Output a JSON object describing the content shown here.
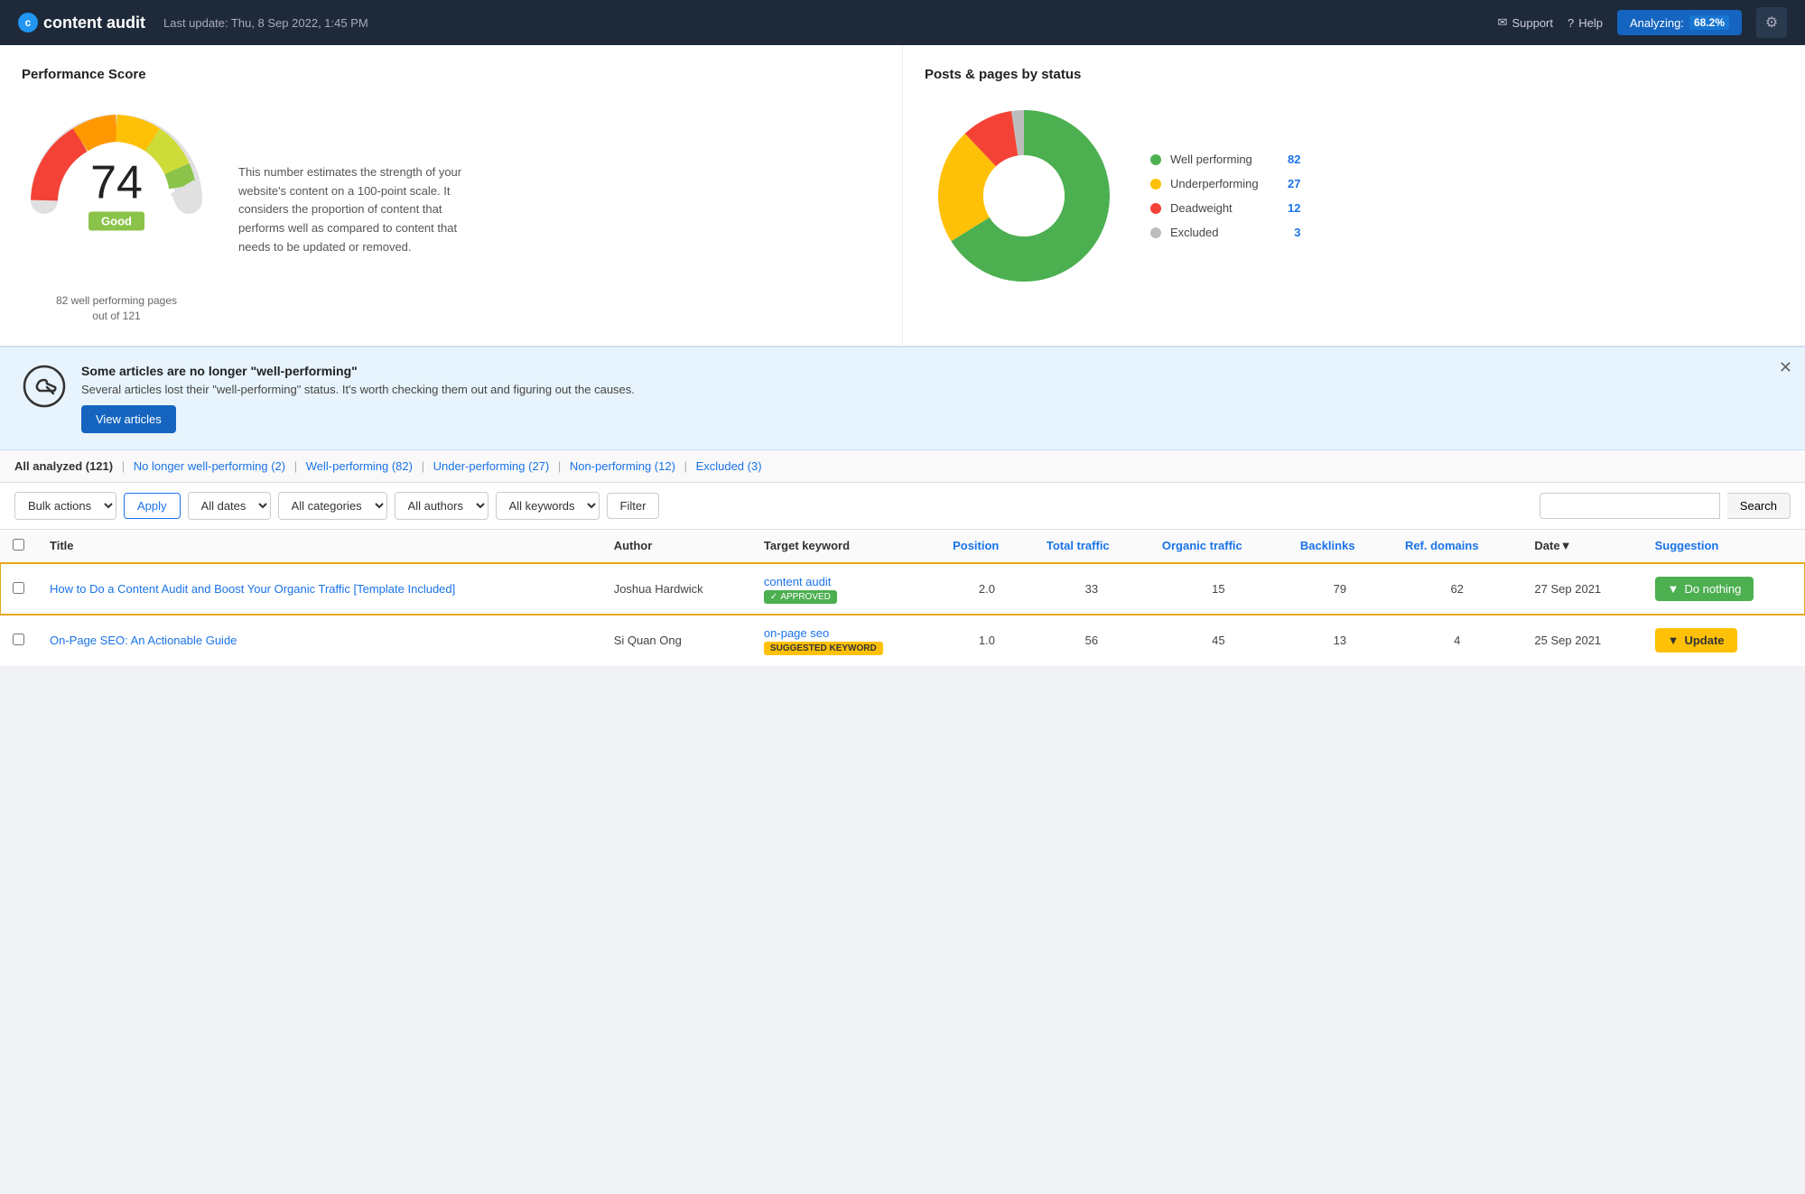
{
  "header": {
    "logo_text": "content audit",
    "logo_icon": "c",
    "update_text": "Last update: Thu, 8 Sep 2022, 1:45 PM",
    "support_label": "Support",
    "help_label": "Help",
    "analyzing_label": "Analyzing:",
    "analyzing_pct": "68.2%",
    "gear_icon": "⚙"
  },
  "performance_score": {
    "title": "Performance Score",
    "score": "74",
    "label": "Good",
    "subtitle": "82 well performing pages\nout of 121",
    "description": "This number estimates the strength of your website's content on a 100-point scale. It considers the proportion of content that performs well as compared to content that needs to be updated or removed."
  },
  "posts_by_status": {
    "title": "Posts & pages by status",
    "legend": [
      {
        "label": "Well performing",
        "count": "82",
        "color": "#4caf50"
      },
      {
        "label": "Underperforming",
        "count": "27",
        "color": "#ffc107"
      },
      {
        "label": "Deadweight",
        "count": "12",
        "color": "#f44336"
      },
      {
        "label": "Excluded",
        "count": "3",
        "color": "#bdbdbd"
      }
    ]
  },
  "alert": {
    "title": "Some articles are no longer \"well-performing\"",
    "description": "Several articles lost their \"well-performing\" status. It's worth checking them out and figuring out the causes.",
    "view_articles_label": "View articles"
  },
  "filter_tabs": [
    {
      "label": "All analyzed",
      "count": "121",
      "active": true
    },
    {
      "label": "No longer well-performing",
      "count": "2",
      "active": false
    },
    {
      "label": "Well-performing",
      "count": "82",
      "active": false
    },
    {
      "label": "Under-performing",
      "count": "27",
      "active": false
    },
    {
      "label": "Non-performing",
      "count": "12",
      "active": false
    },
    {
      "label": "Excluded",
      "count": "3",
      "active": false
    }
  ],
  "toolbar": {
    "bulk_actions_label": "Bulk actions",
    "apply_label": "Apply",
    "all_dates_label": "All dates",
    "all_categories_label": "All categories",
    "all_authors_label": "All authors",
    "all_keywords_label": "All keywords",
    "filter_label": "Filter",
    "search_placeholder": "",
    "search_label": "Search"
  },
  "table": {
    "columns": [
      {
        "label": "Title",
        "sortable": false
      },
      {
        "label": "Author",
        "sortable": false
      },
      {
        "label": "Target keyword",
        "sortable": false
      },
      {
        "label": "Position",
        "sortable": false,
        "blue": true
      },
      {
        "label": "Total traffic",
        "sortable": false,
        "blue": true
      },
      {
        "label": "Organic traffic",
        "sortable": false,
        "blue": true
      },
      {
        "label": "Backlinks",
        "sortable": false,
        "blue": true
      },
      {
        "label": "Ref. domains",
        "sortable": false,
        "blue": true
      },
      {
        "label": "Date",
        "sortable": true,
        "blue": false
      },
      {
        "label": "Suggestion",
        "sortable": false,
        "blue": true
      }
    ],
    "rows": [
      {
        "highlighted": true,
        "title": "How to Do a Content Audit and Boost Your Organic Traffic [Template Included]",
        "author": "Joshua Hardwick",
        "keyword": "content audit",
        "keyword_badge": "APPROVED",
        "keyword_badge_type": "approved",
        "position": "2.0",
        "total_traffic": "33",
        "organic_traffic": "15",
        "backlinks": "79",
        "ref_domains": "62",
        "date": "27 Sep 2021",
        "suggestion": "Do nothing",
        "suggestion_type": "do-nothing"
      },
      {
        "highlighted": false,
        "title": "On-Page SEO: An Actionable Guide",
        "author": "Si Quan Ong",
        "keyword": "on-page seo",
        "keyword_badge": "SUGGESTED KEYWORD",
        "keyword_badge_type": "suggested",
        "position": "1.0",
        "total_traffic": "56",
        "organic_traffic": "45",
        "backlinks": "13",
        "ref_domains": "4",
        "date": "25 Sep 2021",
        "suggestion": "Update",
        "suggestion_type": "update"
      }
    ]
  }
}
